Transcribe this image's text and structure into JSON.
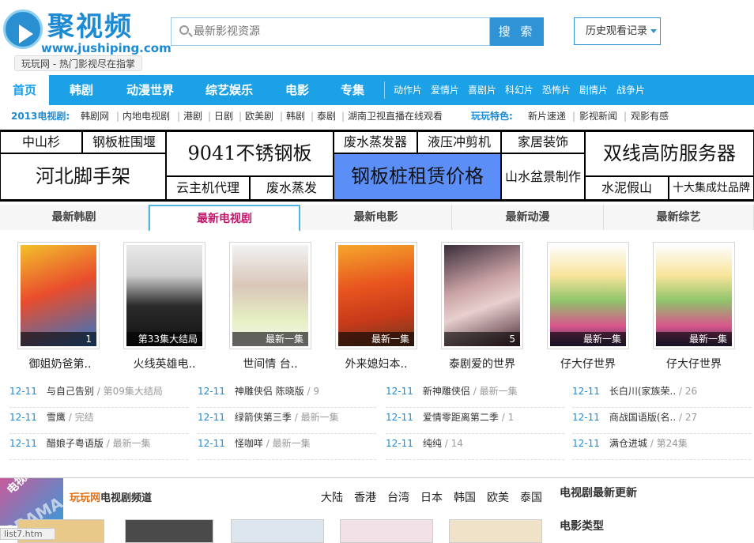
{
  "header": {
    "logo_name": "聚视频",
    "logo_url": "www.jushiping.com",
    "slogan": "玩玩网 - 热门影视尽在指掌",
    "search_placeholder": "最新影视资源",
    "search_button": "搜 索",
    "history_button": "历史观看记录"
  },
  "nav": {
    "items": [
      "首页",
      "韩剧",
      "动漫世界",
      "综艺娱乐",
      "电影",
      "专集"
    ],
    "sub_items": [
      "动作片",
      "爱情片",
      "喜剧片",
      "科幻片",
      "恐怖片",
      "剧情片",
      "战争片"
    ]
  },
  "subnav": {
    "label1": "2013电视剧:",
    "links1": [
      "韩剧网",
      "内地电视剧",
      "港剧",
      "日剧",
      "欧美剧",
      "韩剧",
      "泰剧",
      "湖南卫视直播在线观看"
    ],
    "label2": "玩玩特色:",
    "links2": [
      "新片速递",
      "影视新闻",
      "观影有感"
    ]
  },
  "ads": [
    "中山杉",
    "钢板桩围堰",
    "9041不锈钢板",
    "废水蒸发器",
    "液压冲剪机",
    "家居装饰",
    "双线高防服务器",
    "河北脚手架",
    "云主机代理",
    "废水蒸发",
    "钢板桩租赁价格",
    "山水盆景制作",
    "水泥假山",
    "十大集成灶品牌"
  ],
  "tabs": [
    "最新韩剧",
    "最新电视剧",
    "最新电影",
    "最新动漫",
    "最新综艺"
  ],
  "posters": [
    {
      "title": "御姐奶爸第..",
      "badge": "1"
    },
    {
      "title": "火线英雄电..",
      "badge": "第33集大结局"
    },
    {
      "title": "世间情 台..",
      "badge": "最新一集"
    },
    {
      "title": "外来媳妇本..",
      "badge": "最新一集"
    },
    {
      "title": "泰剧爱的世界",
      "badge": "5"
    },
    {
      "title": "仔大仔世界",
      "badge": "最新一集"
    },
    {
      "title": "仔大仔世界",
      "badge": "最新一集"
    }
  ],
  "lists": [
    [
      {
        "date": "12-11",
        "title": "与自己告别",
        "status": "/ 第09集大结局"
      },
      {
        "date": "12-11",
        "title": "雪鹰",
        "status": "/ 完结"
      },
      {
        "date": "12-11",
        "title": "醋娘子粤语版",
        "status": "/ 最新一集"
      }
    ],
    [
      {
        "date": "12-11",
        "title": "神雕侠侣 陈晓版",
        "status": "/ 9"
      },
      {
        "date": "12-11",
        "title": "绿箭侠第三季",
        "status": "/ 最新一集"
      },
      {
        "date": "12-11",
        "title": "怪咖咩",
        "status": "/ 最新一集"
      }
    ],
    [
      {
        "date": "12-11",
        "title": "新神雕侠侣",
        "status": "/ 最新一集"
      },
      {
        "date": "12-11",
        "title": "爱情零距离第二季",
        "status": "/ 1"
      },
      {
        "date": "12-11",
        "title": "纯纯",
        "status": "/ 14"
      }
    ],
    [
      {
        "date": "12-11",
        "title": "长白川(家族荣..",
        "status": "/ 26"
      },
      {
        "date": "12-11",
        "title": "商战国语版(名..",
        "status": "/ 27"
      },
      {
        "date": "12-11",
        "title": "满仓进城",
        "status": "/ 第24集"
      }
    ]
  ],
  "channel": {
    "badge_cn": "电视剧",
    "badge_en": "DRAMA",
    "title_hl": "玩玩网",
    "title_rest": "电视剧频道",
    "regions": [
      "大陆",
      "香港",
      "台湾",
      "日本",
      "韩国",
      "欧美",
      "泰国"
    ],
    "side_title1": "电视剧最新更新",
    "side_title2": "电影类型"
  },
  "statusbar": "list7.htm",
  "colors": {
    "accent": "#1ca1e6",
    "active_tab": "#c0186a",
    "date": "#1d8ad4"
  }
}
